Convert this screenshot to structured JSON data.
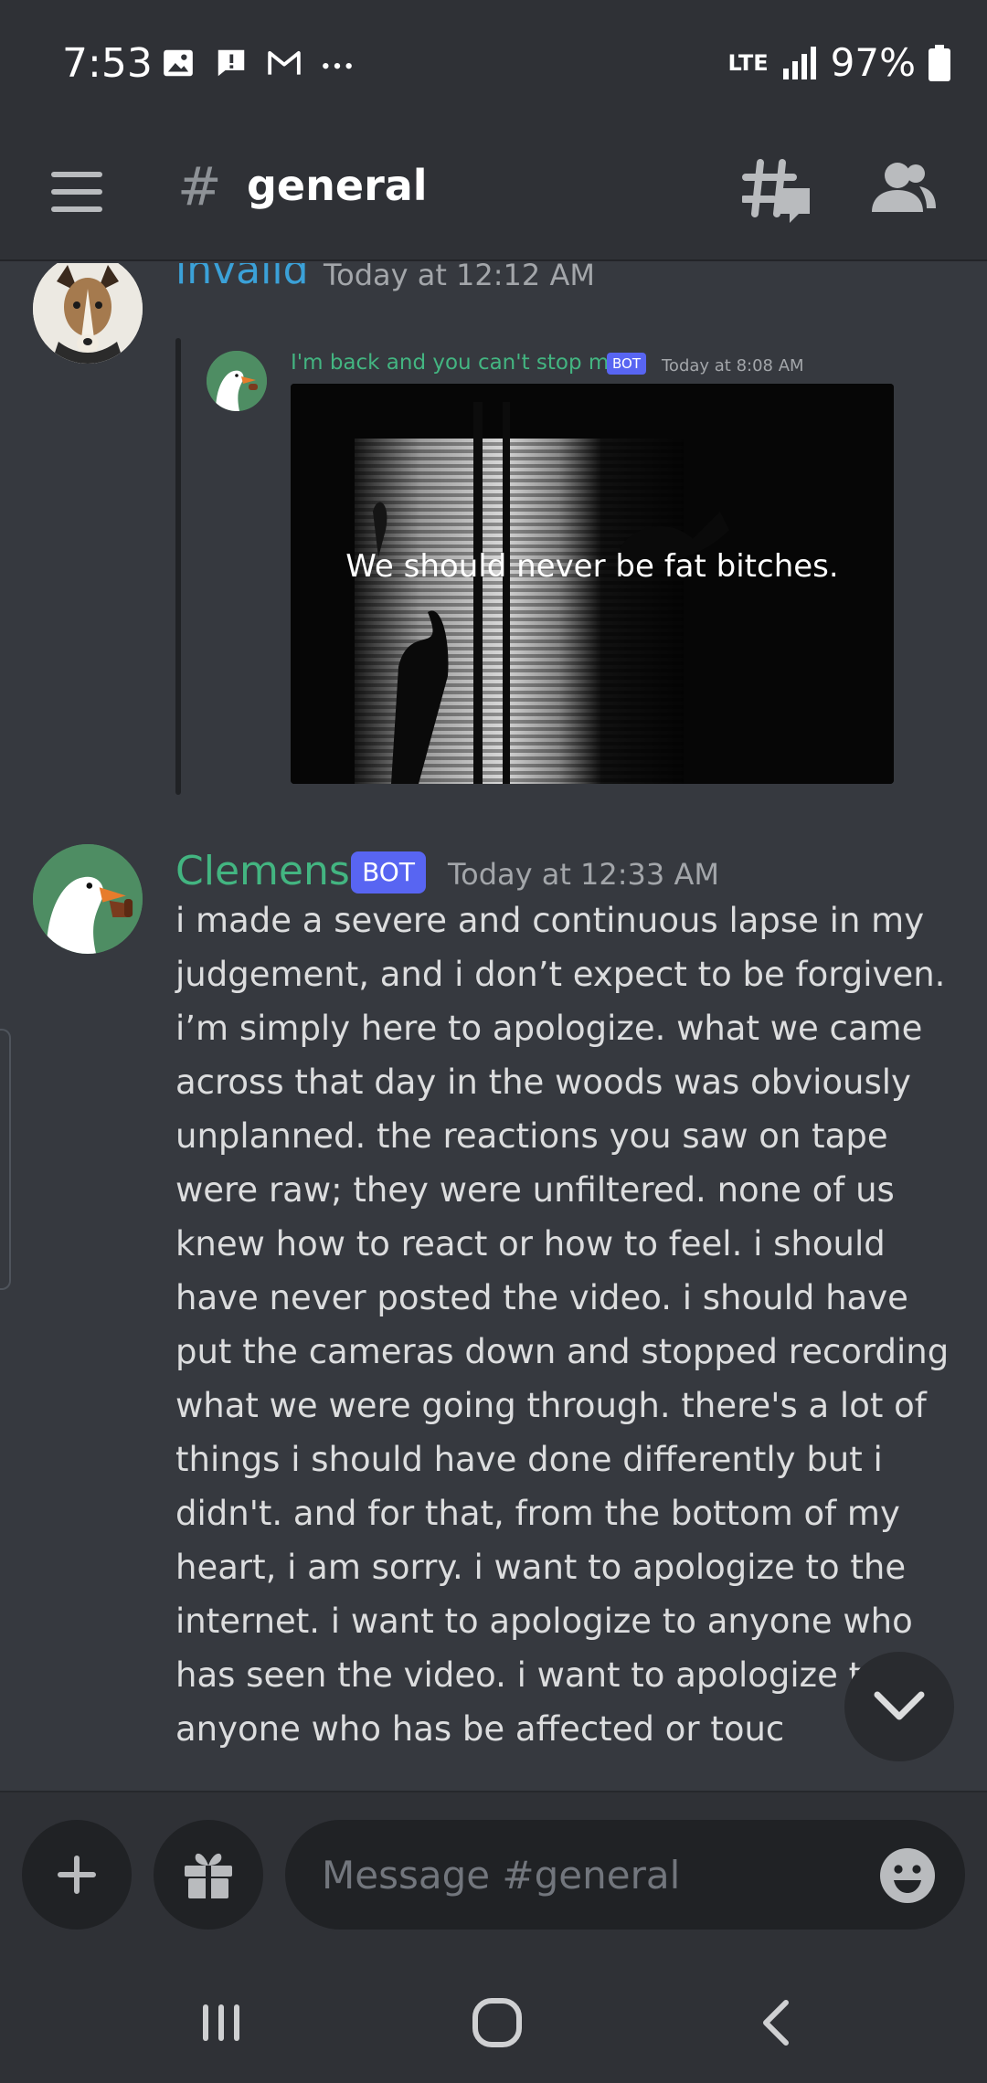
{
  "status_bar": {
    "time": "7:53",
    "network": "LTE",
    "battery": "97%",
    "icons": [
      "gallery-icon",
      "alert-icon",
      "gmail-icon",
      "more-icon",
      "signal-icon",
      "battery-icon"
    ]
  },
  "header": {
    "hash": "#",
    "channel": "general",
    "icons": [
      "menu-icon",
      "threads-icon",
      "members-icon"
    ]
  },
  "messages": [
    {
      "author": "invalid",
      "author_color": "#3ba1d8",
      "timestamp": "Today at 12:12 AM",
      "embed": {
        "author": "I'm back and you can't stop me",
        "author_color": "#43b581",
        "badge": "BOT",
        "timestamp": "Today at 8:08 AM",
        "image_caption": "We should never be fat bitches."
      }
    },
    {
      "author": "Clemens",
      "author_color": "#43b581",
      "badge": "BOT",
      "timestamp": "Today at 12:33 AM",
      "text": "i made a severe and continuous lapse in my judgement, and i don’t expect to be forgiven. i’m simply here to apologize. what we came across that day in the woods was obviously unplanned. the reactions you saw on tape were raw; they were unfiltered. none of us knew how to react or how to feel. i should have never posted the video. i should have put the cameras down and stopped recording what we were going through. there's a lot of things i should have done differently but i didn't. and for that, from the bottom of my heart, i am sorry. i want to apologize to the internet. i want to apologize to anyone who has seen the video. i want to apologize to anyone who has be affected or touc"
    }
  ],
  "composer": {
    "placeholder": "Message #general",
    "icons": [
      "plus-icon",
      "gift-icon",
      "emoji-icon"
    ]
  },
  "navbar": {
    "icons": [
      "recents-icon",
      "home-icon",
      "back-icon"
    ]
  },
  "colors": {
    "background": "#36393f",
    "header": "#2f3136",
    "input": "#202225",
    "blurple": "#5865f2"
  }
}
